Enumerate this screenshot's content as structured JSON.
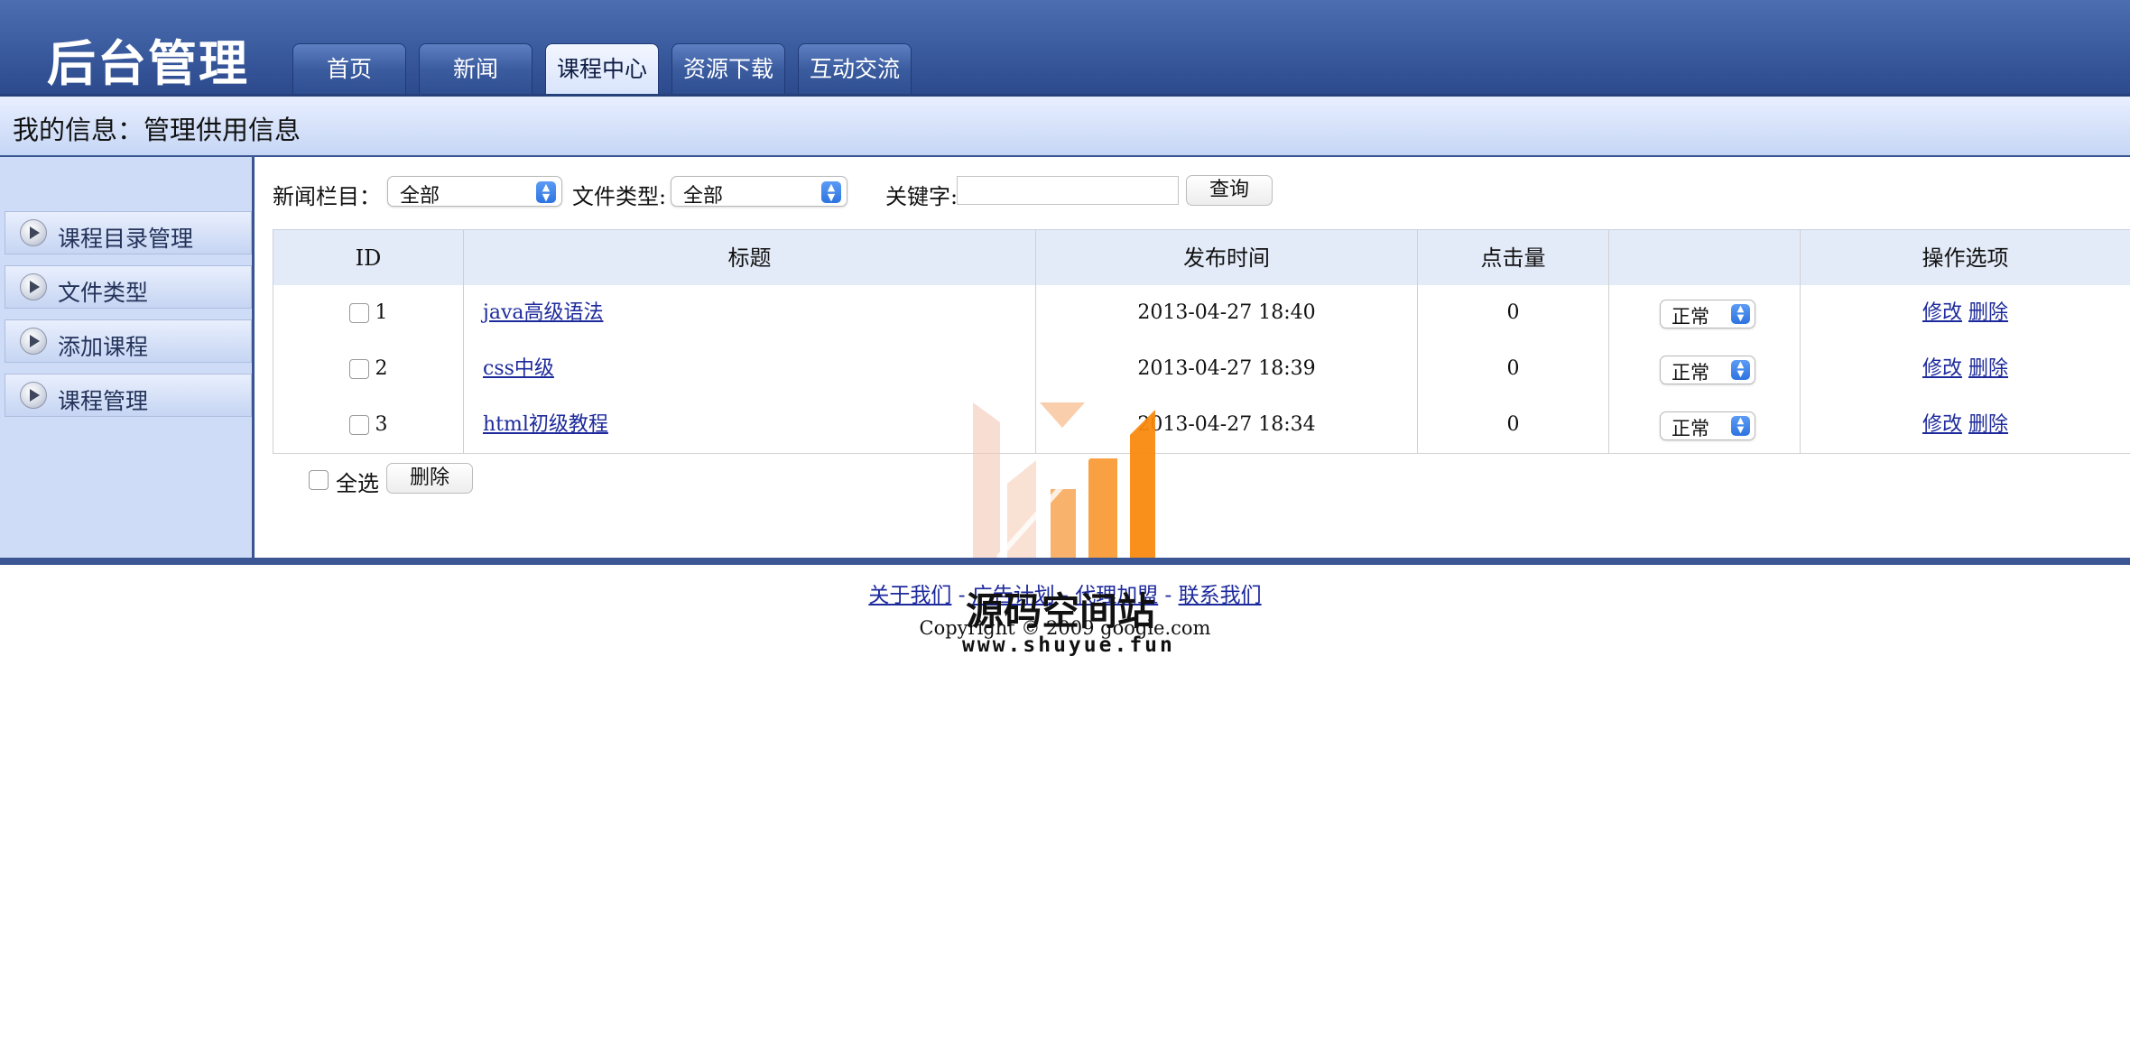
{
  "header": {
    "app_title": "后台管理",
    "tabs": [
      {
        "label": "首页"
      },
      {
        "label": "新闻"
      },
      {
        "label": "课程中心"
      },
      {
        "label": "资源下载"
      },
      {
        "label": "互动交流"
      }
    ],
    "active_tab": "课程中心"
  },
  "infobar": {
    "text": "我的信息：管理供用信息"
  },
  "sidebar": {
    "items": [
      {
        "label": "课程目录管理"
      },
      {
        "label": "文件类型"
      },
      {
        "label": "添加课程"
      },
      {
        "label": "课程管理"
      }
    ]
  },
  "filters": {
    "news_column_label": "新闻栏目：",
    "news_column_value": "全部",
    "file_type_label": "文件类型:",
    "file_type_value": "全部",
    "keyword_label": "关键字:",
    "keyword_value": "",
    "query_button": "查询"
  },
  "table": {
    "headers": [
      "ID",
      "标题",
      "发布时间",
      "点击量",
      "",
      "操作选项"
    ],
    "rows": [
      {
        "id": "1",
        "title": "java高级语法",
        "time": "2013-04-27 18:40",
        "clicks": "0",
        "status": "正常",
        "edit": "修改",
        "delete": "删除"
      },
      {
        "id": "2",
        "title": "css中级",
        "time": "2013-04-27 18:39",
        "clicks": "0",
        "status": "正常",
        "edit": "修改",
        "delete": "删除"
      },
      {
        "id": "3",
        "title": "html初级教程",
        "time": "2013-04-27 18:34",
        "clicks": "0",
        "status": "正常",
        "edit": "修改",
        "delete": "删除"
      }
    ]
  },
  "bulk": {
    "select_all_label": "全选",
    "delete_button": "删除"
  },
  "footer": {
    "links": [
      "关于我们",
      "广告计划",
      "代理加盟",
      "联系我们"
    ],
    "separator": " - ",
    "copyright": "Copyright © 2009 google.com"
  },
  "watermark": {
    "name": "源码空间站",
    "url": "www.shuyue.fun"
  },
  "colors": {
    "header_bg": "#3a5a9e",
    "active_tab_bg": "#d9e4fb",
    "sidebar_bg": "#cfdcf7",
    "table_header_bg": "#e4ebf8",
    "link": "#1d2a9c",
    "select_arrow": "#2d74e0"
  }
}
